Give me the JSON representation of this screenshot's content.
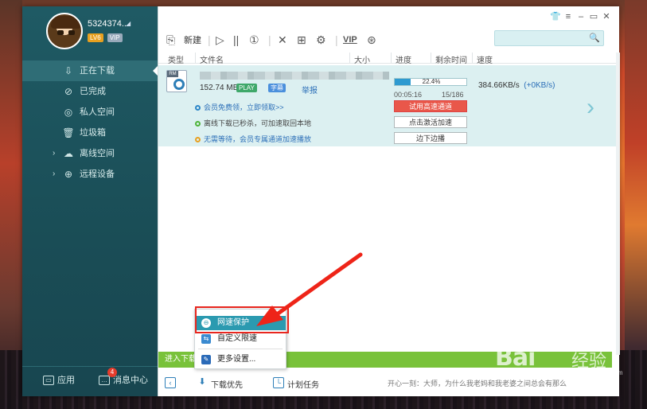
{
  "user": {
    "name": "5324374...",
    "level_badge": "LV6",
    "vip_badge": "VIP"
  },
  "sidebar": {
    "items": [
      {
        "label": "正在下载",
        "icon": "download-icon"
      },
      {
        "label": "已完成",
        "icon": "check-circle-icon"
      },
      {
        "label": "私人空间",
        "icon": "private-space-icon"
      },
      {
        "label": "垃圾箱",
        "icon": "trash-icon"
      },
      {
        "label": "离线空间",
        "icon": "offline-space-icon"
      },
      {
        "label": "远程设备",
        "icon": "remote-device-icon"
      }
    ],
    "bottom": {
      "apps_label": "应用",
      "messages_label": "消息中心",
      "messages_count": "4"
    }
  },
  "toolbar": {
    "new_label": "新建",
    "vip_label": "VIP"
  },
  "columns": {
    "type": "类型",
    "filename": "文件名",
    "size": "大小",
    "progress": "进度",
    "remaining": "剩余时间",
    "speed": "速度"
  },
  "task": {
    "size": "152.74 MB",
    "play_badge": "PLAY",
    "subtitle_badge": "字幕",
    "report_link": "举报",
    "hints": [
      "会员免费领，立即领取>>",
      "离线下载已秒杀，可加速取回本地",
      "无需等待，会员专属通道加速播放"
    ],
    "progress_text": "22.4%",
    "progress_value": 22.4,
    "elapsed": "00:05:16",
    "ratio": "15/186",
    "speed_main": "384.66KB/s",
    "speed_extra": "(+0KB/s)",
    "buttons": {
      "trial": "试用高速通道",
      "activate": "点击激活加速",
      "side_play": "边下边播"
    }
  },
  "footer": {
    "green_bar": "进入下载",
    "priority_label": "下载优先",
    "schedule_label": "计划任务",
    "ticker": "开心一刻：大师，为什么我老妈和我老婆之间总会有那么"
  },
  "popup_menu": {
    "items": [
      "网速保护",
      "自定义限速",
      "更多设置..."
    ]
  },
  "watermark": {
    "brand": "Bai",
    "brand_cn": "经验",
    "url": "jingyan.baidu.com"
  },
  "colors": {
    "sidebar": "#1f5a64",
    "accent": "#2b9ab0",
    "highlight": "#e8261e",
    "green_bar": "#79c23a",
    "row_bg": "#dcf0f1"
  }
}
